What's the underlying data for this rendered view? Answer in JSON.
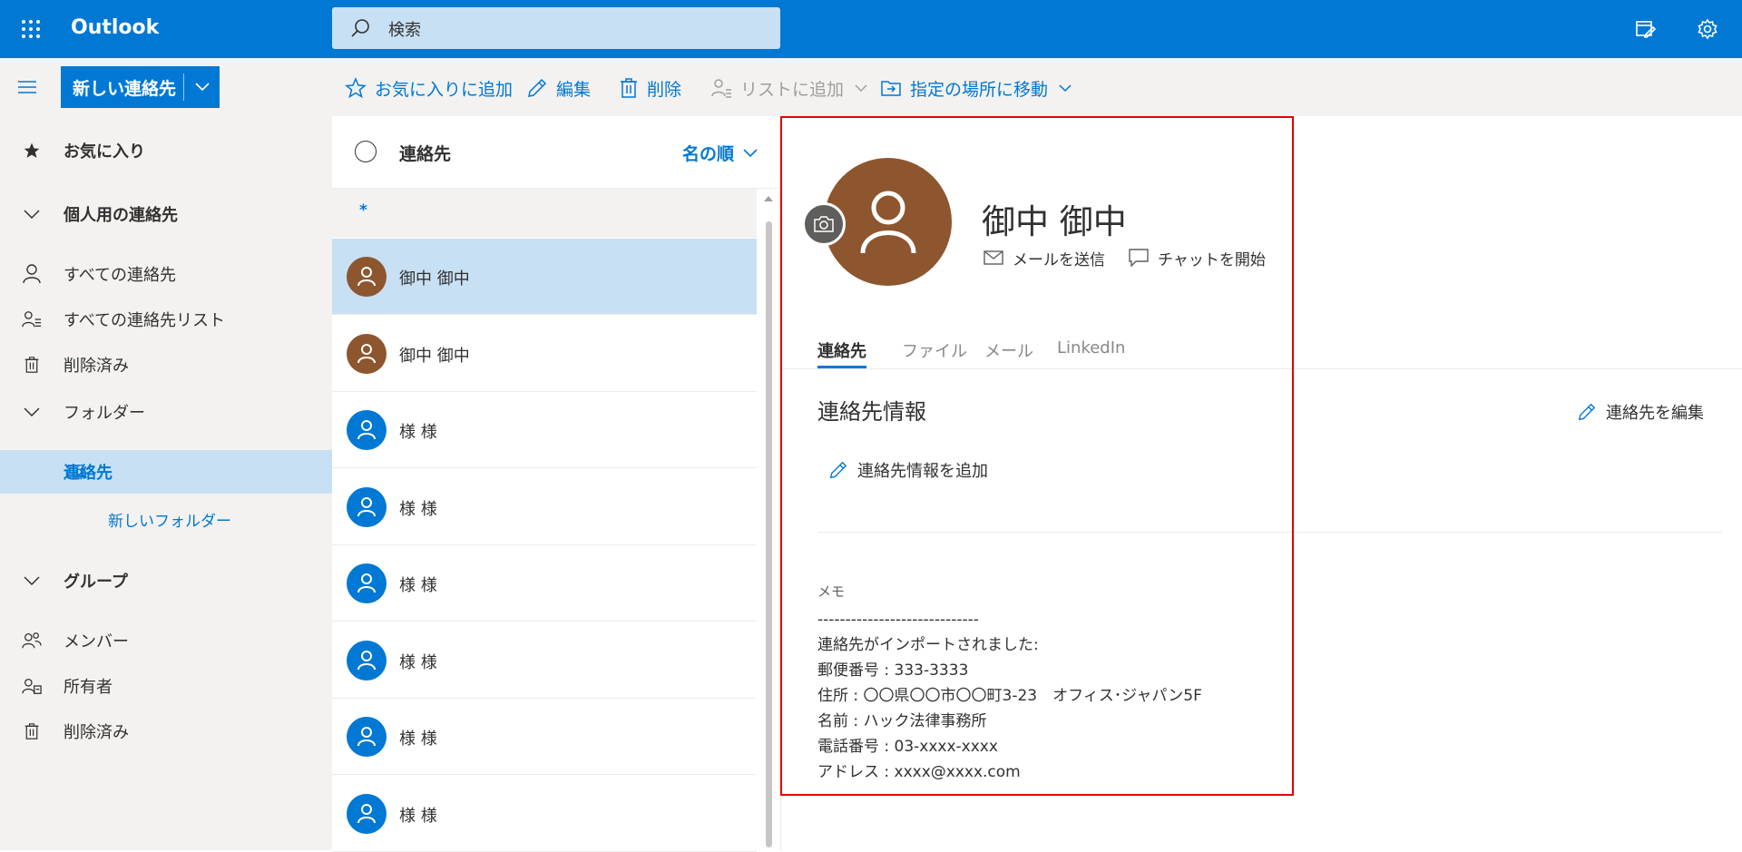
{
  "app": {
    "title": "Outlook"
  },
  "search": {
    "placeholder": "検索"
  },
  "toolbar": {
    "new_contact": "新しい連絡先",
    "favorite": "お気に入りに追加",
    "edit": "編集",
    "delete": "削除",
    "add_to_list": "リストに追加",
    "move_to": "指定の場所に移動"
  },
  "sidebar": {
    "favorites": "お気に入り",
    "personal_contacts": "個人用の連絡先",
    "all_contacts": "すべての連絡先",
    "all_contact_lists": "すべての連絡先リスト",
    "deleted": "削除済み",
    "folders": "フォルダー",
    "contacts": "連絡先",
    "new_folder": "新しいフォルダー",
    "groups": "グループ",
    "members": "メンバー",
    "owner": "所有者",
    "groups_deleted": "削除済み"
  },
  "list": {
    "title": "連絡先",
    "sort": "名の順",
    "group_header": "*",
    "contacts": [
      {
        "name": "御中 御中",
        "color": "#8e562e"
      },
      {
        "name": "御中 御中",
        "color": "#8e562e"
      },
      {
        "name": "様 様",
        "color": "#0078d4"
      },
      {
        "name": "様 様",
        "color": "#0078d4"
      },
      {
        "name": "様 様",
        "color": "#0078d4"
      },
      {
        "name": "様 様",
        "color": "#0078d4"
      },
      {
        "name": "様 様",
        "color": "#0078d4"
      },
      {
        "name": "様 様",
        "color": "#0078d4"
      }
    ]
  },
  "detail": {
    "name": "御中 御中",
    "send_mail": "メールを送信",
    "start_chat": "チャットを開始",
    "tabs": [
      "連絡先",
      "ファイル",
      "メール",
      "LinkedIn"
    ],
    "section_title": "連絡先情報",
    "edit_contact": "連絡先を編集",
    "add_info": "連絡先情報を追加",
    "memo_label": "メモ",
    "memo_lines": [
      "-----------------------------",
      "連絡先がインポートされました:",
      "郵便番号 : 333-3333",
      "住所 : 〇〇県〇〇市〇〇町3-23　オフィス･ジャパン5F",
      "名前 : ハック法律事務所",
      "電話番号 : 03-xxxx-xxxx",
      "アドレス : xxxx@xxxx.com"
    ]
  },
  "colors": {
    "accent": "#0078d4",
    "highlight": "#e50000",
    "avatar_brown": "#8e562e"
  }
}
